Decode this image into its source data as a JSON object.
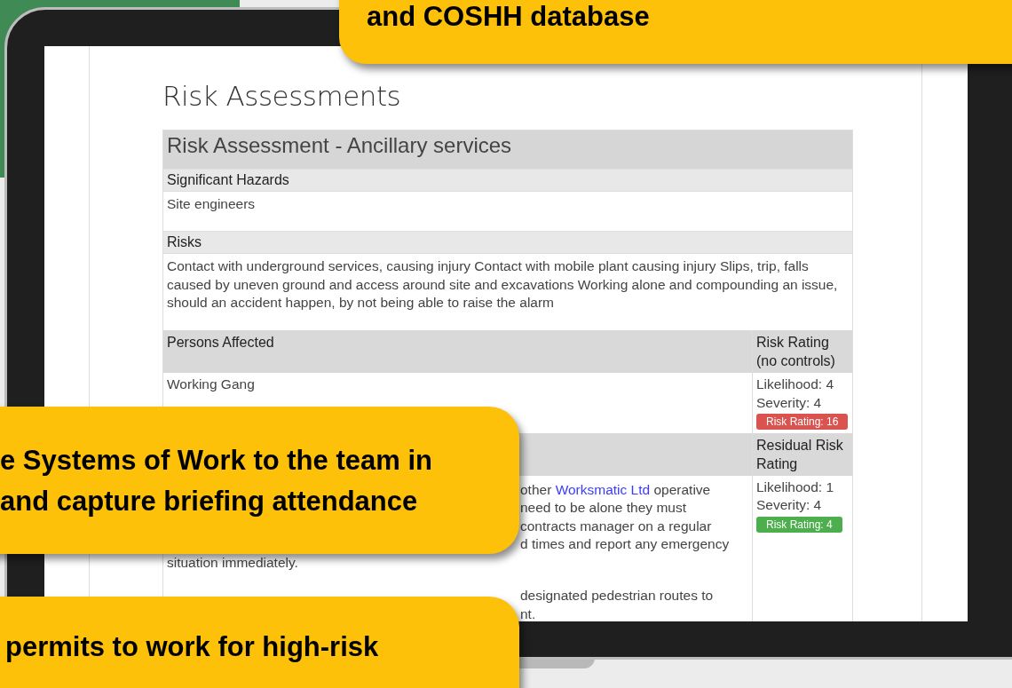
{
  "page_title": "Risk Assessments",
  "assessment": {
    "title": "Risk Assessment - Ancillary services",
    "hazards_label": "Significant Hazards",
    "hazards": "Site engineers",
    "risks_label": "Risks",
    "risks": "Contact with underground services, causing injury Contact with mobile plant causing injury Slips, trip, falls caused by uneven ground and access around site and excavations Working alone and compounding an issue, should an accident happen, by not being able to raise the alarm",
    "persons_label": "Persons Affected",
    "rating_label": "Risk Rating (no controls)",
    "persons": "Working Gang",
    "initial": {
      "likelihood": "Likelihood: 4",
      "severity": "Severity: 4",
      "badge": "Risk Rating: 16",
      "color": "#d9534f"
    },
    "residual_label": "Residual Risk Rating",
    "control_lines": [
      {
        "kind": "partial",
        "text": "other ",
        "link": "Worksmatic Ltd",
        "after": " operative"
      },
      {
        "kind": "partial",
        "text": "need to be alone they must"
      },
      {
        "kind": "partial",
        "text": "contracts manager on a regular"
      },
      {
        "kind": "partial",
        "text": "d times and report any emergency"
      },
      {
        "kind": "full",
        "text": "situation immediately."
      },
      {
        "kind": "gap"
      },
      {
        "kind": "partial",
        "text": "designated pedestrian routes to"
      },
      {
        "kind": "partial",
        "text": "nt."
      }
    ],
    "residual": {
      "likelihood": "Likelihood: 1",
      "severity": "Severity: 4",
      "badge": "Risk Rating: 4",
      "color": "#4cae4c"
    }
  },
  "callouts": [
    {
      "kind": "top",
      "lines": [
        "and COSHH database"
      ]
    },
    {
      "kind": "middle",
      "lines": [
        "e Systems of Work to the team in",
        "and capture briefing attendance"
      ]
    },
    {
      "kind": "bottom",
      "lines": [
        "permits to work for high-risk"
      ]
    }
  ]
}
